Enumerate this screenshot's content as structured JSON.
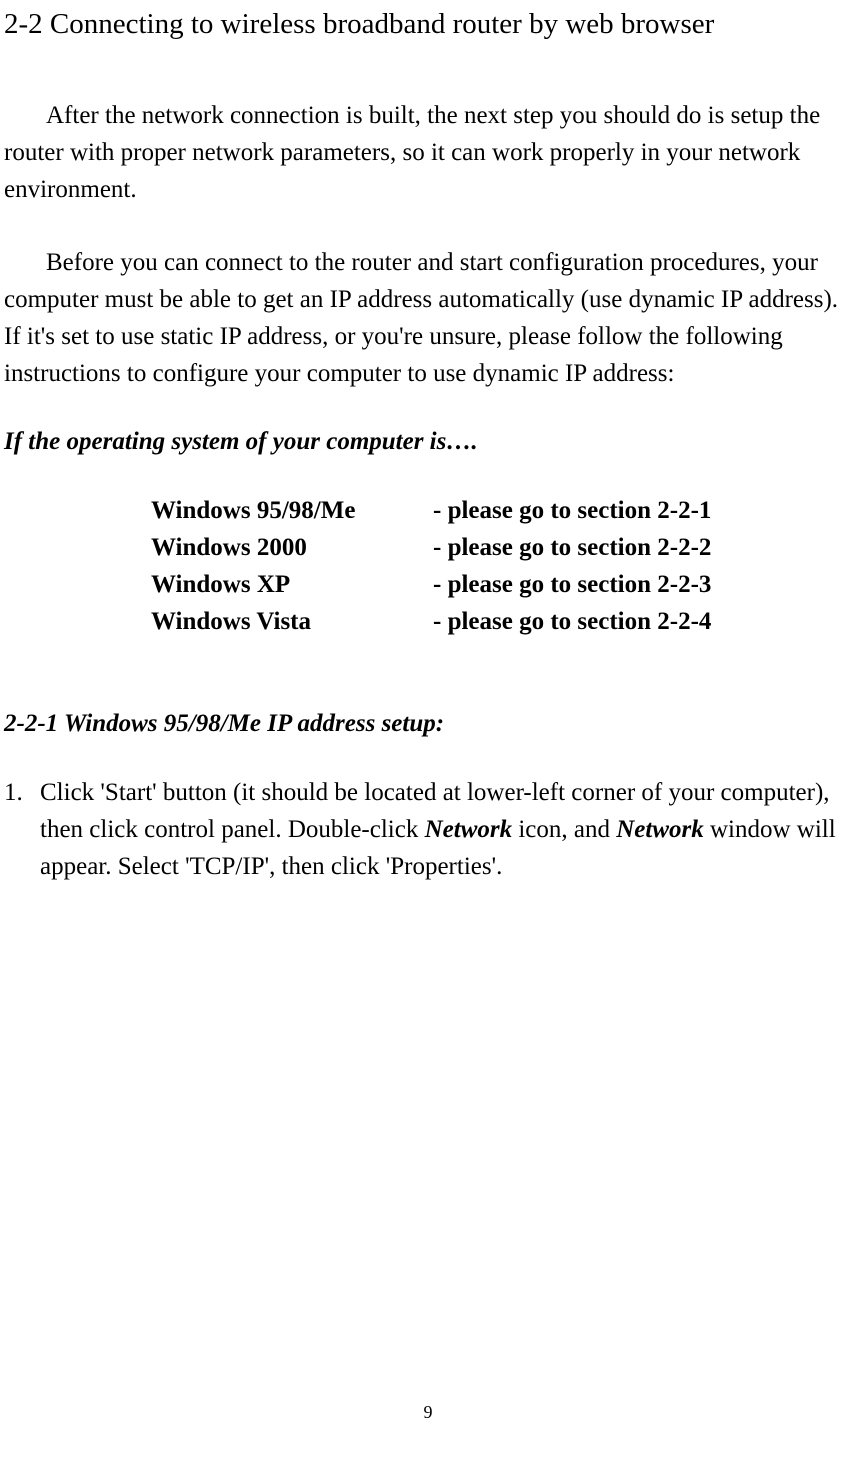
{
  "heading": "2-2 Connecting to wireless broadband router by web browser",
  "paragraph1": "After the network connection is built, the next step you should do is setup the router with proper network parameters, so it can work properly in your network environment.",
  "paragraph2": "Before you can connect to the router and start configuration procedures, your computer must be able to get an IP address automatically (use dynamic IP address). If it's set to use static IP address, or you're unsure, please follow the following instructions to configure your computer to use dynamic IP address:",
  "osHeading": "If the operating system of your computer is….",
  "osTable": [
    {
      "name": "Windows 95/98/Me",
      "ref": "- please go to section 2-2-1"
    },
    {
      "name": "Windows 2000",
      "ref": "- please go to section 2-2-2"
    },
    {
      "name": "Windows XP",
      "ref": "- please go to section 2-2-3"
    },
    {
      "name": "Windows Vista",
      "ref": "- please go to section 2-2-4"
    }
  ],
  "subsectionHeading": "2-2-1 Windows 95/98/Me IP address setup:",
  "step1": {
    "number": "1.",
    "pre": "Click 'Start' button (it should be located at lower-left corner of your computer), then click control panel. Double-click ",
    "em1": "Network",
    "mid": " icon, and ",
    "em2": "Network",
    "post": " window will appear. Select 'TCP/IP', then click 'Properties'."
  },
  "pageNumber": "9"
}
